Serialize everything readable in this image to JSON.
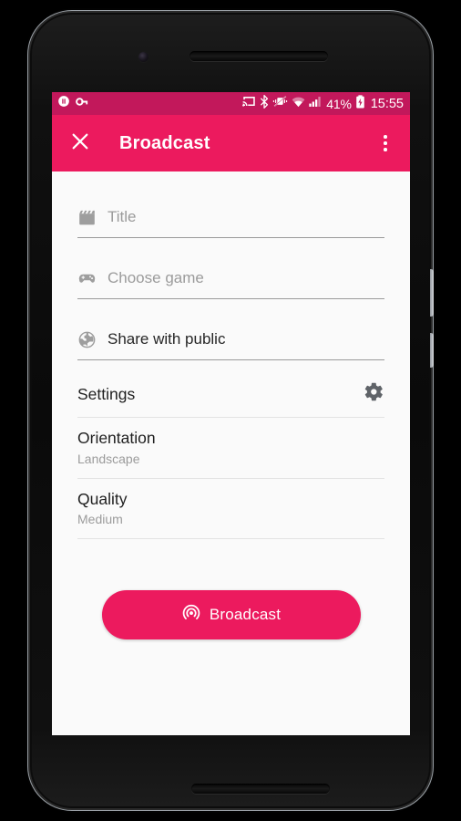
{
  "device": {
    "type": "android-phone-mockup",
    "features": [
      "front-camera",
      "earpiece-speaker",
      "bottom-speaker",
      "power-button",
      "volume-button"
    ]
  },
  "status_bar": {
    "background_color": "#C2185B",
    "left_icons": [
      {
        "name": "pause-notification-icon",
        "label": "Pause"
      },
      {
        "name": "vpn-key-icon",
        "label": "VPN"
      }
    ],
    "right_icons": [
      {
        "name": "cast-icon",
        "label": "Cast"
      },
      {
        "name": "bluetooth-icon",
        "label": "Bluetooth"
      },
      {
        "name": "vibrate-off-icon",
        "label": "Vibrate off"
      },
      {
        "name": "wifi-icon",
        "label": "Wi-Fi"
      },
      {
        "name": "cell-signal-icon",
        "label": "Signal"
      }
    ],
    "battery_percent": "41%",
    "battery_state": "charging",
    "clock": "15:55"
  },
  "app_bar": {
    "background_color": "#EC1A5E",
    "close_icon": "close-icon",
    "title": "Broadcast",
    "overflow_icon": "more-vert-icon"
  },
  "form": {
    "fields": [
      {
        "icon": "movie-clapperboard-icon",
        "placeholder": "Title",
        "value": "",
        "filled": false
      },
      {
        "icon": "gamepad-icon",
        "placeholder": "Choose game",
        "value": "",
        "filled": false
      },
      {
        "icon": "globe-public-icon",
        "placeholder": "Share with public",
        "value": "Share with public",
        "filled": true
      }
    ]
  },
  "settings": {
    "header_label": "Settings",
    "header_icon": "gear-icon",
    "rows": [
      {
        "title": "Orientation",
        "value": "Landscape"
      },
      {
        "title": "Quality",
        "value": "Medium"
      }
    ]
  },
  "primary_action": {
    "label": "Broadcast",
    "icon": "broadcast-waves-icon",
    "background_color": "#EC1A5E",
    "text_color": "#FFFFFF"
  }
}
